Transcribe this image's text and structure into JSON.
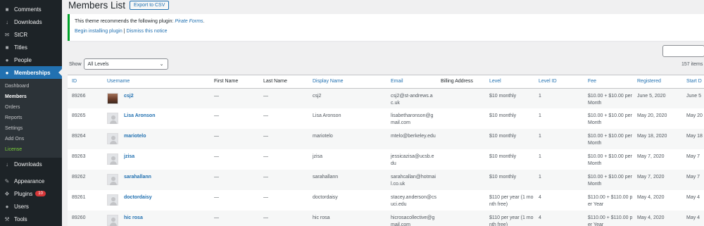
{
  "sidebar": {
    "items_top": [
      {
        "icon": "comment-icon",
        "glyph": "■",
        "label": "Comments"
      },
      {
        "icon": "download-icon",
        "glyph": "↓",
        "label": "Downloads"
      },
      {
        "icon": "stcr-icon",
        "glyph": "✉",
        "label": "StCR"
      },
      {
        "icon": "titles-icon",
        "glyph": "■",
        "label": "Titles"
      },
      {
        "icon": "people-icon",
        "glyph": "●",
        "label": "People"
      }
    ],
    "active": {
      "icon": "memberships-icon",
      "glyph": "●",
      "label": "Memberships"
    },
    "submenu": [
      "Dashboard",
      "Members",
      "Orders",
      "Reports",
      "Settings",
      "Add Ons",
      "License"
    ],
    "items_mid": [
      {
        "icon": "download-icon",
        "glyph": "↓",
        "label": "Downloads"
      }
    ],
    "items_bottom": [
      {
        "icon": "appearance-icon",
        "glyph": "✎",
        "label": "Appearance"
      },
      {
        "icon": "plugins-icon",
        "glyph": "❖",
        "label": "Plugins",
        "badge": "10"
      },
      {
        "icon": "users-icon",
        "glyph": "●",
        "label": "Users"
      },
      {
        "icon": "tools-icon",
        "glyph": "⚒",
        "label": "Tools"
      }
    ]
  },
  "header": {
    "title": "Members List",
    "export_label": "Export to CSV"
  },
  "notice": {
    "text": "This theme recommends the following plugin: ",
    "plugin": "Pirate Forms",
    "period": ".",
    "install_link": "Begin installing plugin",
    "separator": "|",
    "dismiss_link": "Dismiss this notice"
  },
  "filter": {
    "show_label": "Show",
    "level_value": "All Levels",
    "items_count": "157 items"
  },
  "table": {
    "columns": [
      "ID",
      "Username",
      "First Name",
      "Last Name",
      "Display Name",
      "Email",
      "Billing Address",
      "Level",
      "Level ID",
      "Fee",
      "Registered",
      "Start D"
    ],
    "rows": [
      {
        "id": "89266",
        "username": "csj2",
        "first": "—",
        "last": "—",
        "display": "csj2",
        "email": "csj2@st-andrews.ac.uk",
        "billing": "",
        "level": "$10 monthly",
        "level_id": "1",
        "fee": "$10.00 + $10.00 per Month",
        "registered": "June 5, 2020",
        "start": "June 5"
      },
      {
        "id": "89265",
        "username": "Lisa Aronson",
        "first": "—",
        "last": "—",
        "display": "Lisa Aronson",
        "email": "lisabetharonson@gmail.com",
        "billing": "",
        "level": "$10 monthly",
        "level_id": "1",
        "fee": "$10.00 + $10.00 per Month",
        "registered": "May 20, 2020",
        "start": "May 20"
      },
      {
        "id": "89264",
        "username": "mariotelo",
        "first": "—",
        "last": "—",
        "display": "mariotelo",
        "email": "mtelo@berkeley.edu",
        "billing": "",
        "level": "$10 monthly",
        "level_id": "1",
        "fee": "$10.00 + $10.00 per Month",
        "registered": "May 18, 2020",
        "start": "May 18"
      },
      {
        "id": "89263",
        "username": "jzisa",
        "first": "—",
        "last": "—",
        "display": "jzisa",
        "email": "jessicazisa@ucsb.edu",
        "billing": "",
        "level": "$10 monthly",
        "level_id": "1",
        "fee": "$10.00 + $10.00 per Month",
        "registered": "May 7, 2020",
        "start": "May 7"
      },
      {
        "id": "89262",
        "username": "sarahallann",
        "first": "—",
        "last": "—",
        "display": "sarahallann",
        "email": "sarahcallan@hotmail.co.uk",
        "billing": "",
        "level": "$10 monthly",
        "level_id": "1",
        "fee": "$10.00 + $10.00 per Month",
        "registered": "May 7, 2020",
        "start": "May 7"
      },
      {
        "id": "89261",
        "username": "doctordaisy",
        "first": "—",
        "last": "—",
        "display": "doctordaisy",
        "email": "stacey.anderson@csuci.edu",
        "billing": "",
        "level": "$110 per year (1 month free)",
        "level_id": "4",
        "fee": "$110.00 + $110.00 per Year",
        "registered": "May 4, 2020",
        "start": "May 4"
      },
      {
        "id": "89260",
        "username": "hic rosa",
        "first": "—",
        "last": "—",
        "display": "hic rosa",
        "email": "hicrosacollective@gmail.com",
        "billing": "",
        "level": "$110 per year (1 month free)",
        "level_id": "4",
        "fee": "$110.00 + $110.00 per Year",
        "registered": "May 4, 2020",
        "start": "May 4"
      }
    ]
  }
}
